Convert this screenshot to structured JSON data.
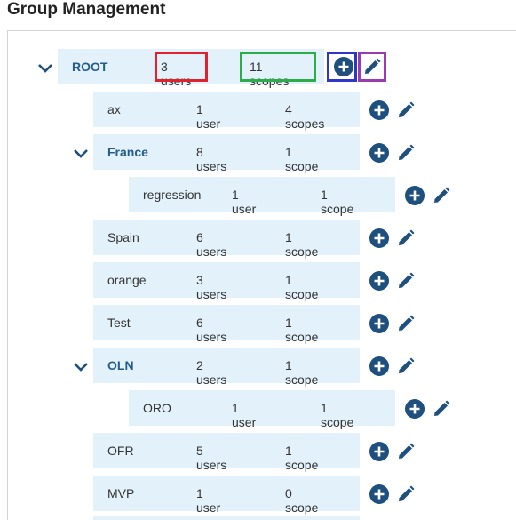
{
  "page": {
    "title": "Group Management"
  },
  "tree": [
    {
      "name": "ROOT",
      "users": "3 users",
      "scopes": "11 scopes",
      "group": true,
      "expanded": true
    },
    {
      "name": "ax",
      "users": "1 user",
      "scopes": "4 scopes",
      "group": false
    },
    {
      "name": "France",
      "users": "8 users",
      "scopes": "1 scope",
      "group": true,
      "expanded": true
    },
    {
      "name": "regression",
      "users": "1 user",
      "scopes": "1 scope",
      "group": false
    },
    {
      "name": "Spain",
      "users": "6 users",
      "scopes": "1 scope",
      "group": false
    },
    {
      "name": "orange",
      "users": "3 users",
      "scopes": "1 scope",
      "group": false
    },
    {
      "name": "Test",
      "users": "6 users",
      "scopes": "1 scope",
      "group": false
    },
    {
      "name": "OLN",
      "users": "2 users",
      "scopes": "1 scope",
      "group": true,
      "expanded": true
    },
    {
      "name": "ORO",
      "users": "1 user",
      "scopes": "1 scope",
      "group": false
    },
    {
      "name": "OFR",
      "users": "5 users",
      "scopes": "1 scope",
      "group": false
    },
    {
      "name": "MVP",
      "users": "1 user",
      "scopes": "0 scope",
      "group": false
    }
  ],
  "icons": {
    "expand": "chevron-down-icon",
    "add": "plus-circle-icon",
    "edit": "pencil-icon"
  },
  "colors": {
    "row_bg": "#e3f1fa",
    "group_text": "#245c8c",
    "action_icon": "#1e4f7d",
    "highlight_users": "#e0212e",
    "highlight_scopes": "#2aad4a",
    "highlight_add": "#2f35c8",
    "highlight_edit": "#9a3bb0"
  }
}
